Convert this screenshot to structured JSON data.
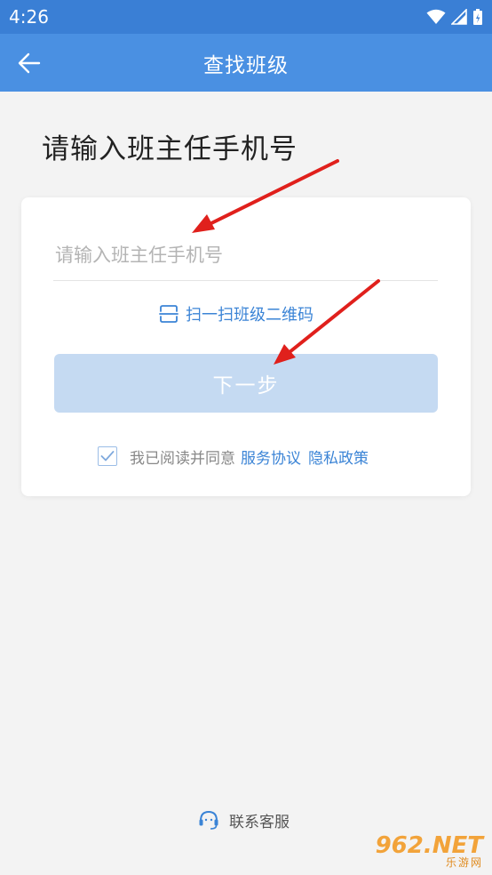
{
  "status_bar": {
    "time": "4:26"
  },
  "app_bar": {
    "title": "查找班级"
  },
  "heading": "请输入班主任手机号",
  "form": {
    "phone_placeholder": "请输入班主任手机号",
    "phone_value": "",
    "scan_label": "扫一扫班级二维码",
    "next_label": "下一步",
    "agreement_checked": true,
    "agreement_prefix": "我已阅读并同意",
    "service_link": "服务协议",
    "privacy_link": "隐私政策"
  },
  "footer": {
    "contact_label": "联系客服"
  },
  "watermark": {
    "logo_text": "962.NET",
    "site_name": "乐游网"
  },
  "colors": {
    "status_bar": "#3a7fd5",
    "app_bar": "#4a90e2",
    "accent": "#3b84d6",
    "button_disabled": "#c5daf2",
    "annotation_arrow": "#e0201c"
  },
  "icons": {
    "back": "arrow-left-icon",
    "wifi": "wifi-icon",
    "signal": "cell-signal-icon",
    "battery": "battery-icon",
    "scan": "scan-icon",
    "checkbox": "checkmark-icon",
    "contact": "headset-icon"
  }
}
